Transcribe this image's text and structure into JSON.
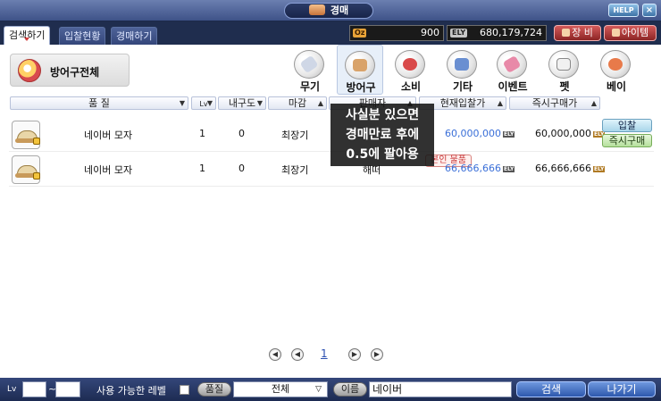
{
  "window": {
    "title": "경매",
    "help": "HELP",
    "close": "×"
  },
  "tabs": [
    "검색하기",
    "입찰현황",
    "경매하기"
  ],
  "wallet": {
    "zeny_tag": "Oz",
    "zeny": "900",
    "ely_tag": "ELY",
    "ely": "680,179,724"
  },
  "top_buttons": {
    "equip": "장 비",
    "item": "아이템"
  },
  "category_title": "방어구전체",
  "categories": [
    "무기",
    "방어구",
    "소비",
    "기타",
    "이벤트",
    "펫",
    "베이"
  ],
  "columns": {
    "quality": "품 질",
    "lv": "Lv",
    "durability": "내구도",
    "deadline": "마감",
    "seller": "판매자",
    "current_bid": "현재입찰가",
    "buyout": "즉시구매가"
  },
  "rows": [
    {
      "name": "네이버 모자",
      "lv": "1",
      "durability": "0",
      "deadline": "최장기",
      "seller": "",
      "current_bid": "60,000,000",
      "buyout": "60,000,000",
      "bid_label": "입찰",
      "buy_label": "즉시구매"
    },
    {
      "name": "네이버 모자",
      "lv": "1",
      "durability": "0",
      "deadline": "최장기",
      "seller": "해떠",
      "own_badge": "본인 물품",
      "current_bid": "66,666,666",
      "buyout": "66,666,666"
    }
  ],
  "ely_small": "ELY",
  "tooltip": [
    "사실분 있으면",
    "경매만료 후에",
    "0.5에 팔아용"
  ],
  "pager": {
    "current": "1"
  },
  "bottom": {
    "lv_label": "Lv",
    "lv_min": "",
    "lv_sep": "~",
    "lv_max": "",
    "usable_level": "사용 가능한 레벨",
    "quality_label": "품질",
    "quality_value": "전체",
    "name_label": "이름",
    "name_value": "네이버",
    "search": "검색",
    "exit": "나가기"
  }
}
